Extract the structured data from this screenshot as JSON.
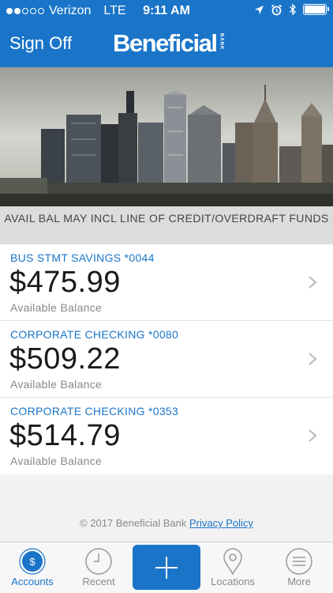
{
  "status_bar": {
    "carrier": "Verizon",
    "network": "LTE",
    "time": "9:11 AM"
  },
  "header": {
    "sign_off_label": "Sign Off",
    "logo_text": "Beneficial",
    "logo_subtext": "BANK",
    "background_color": "#1a75c9"
  },
  "notice": "AVAIL BAL MAY INCL LINE OF CREDIT/OVERDRAFT FUNDS",
  "accounts": [
    {
      "name": "BUS STMT SAVINGS *0044",
      "amount": "$475.99",
      "label": "Available Balance"
    },
    {
      "name": "CORPORATE CHECKING *0080",
      "amount": "$509.22",
      "label": "Available Balance"
    },
    {
      "name": "CORPORATE CHECKING *0353",
      "amount": "$514.79",
      "label": "Available Balance"
    }
  ],
  "footer": {
    "copyright": "© 2017 Beneficial Bank",
    "privacy_link": "Privacy Policy"
  },
  "tabs": [
    {
      "label": "Accounts",
      "icon": "dollar-icon",
      "active": true
    },
    {
      "label": "Recent",
      "icon": "clock-icon",
      "active": false
    },
    {
      "label": "",
      "icon": "plus-icon",
      "active": false
    },
    {
      "label": "Locations",
      "icon": "location-pin-icon",
      "active": false
    },
    {
      "label": "More",
      "icon": "menu-icon",
      "active": false
    }
  ]
}
